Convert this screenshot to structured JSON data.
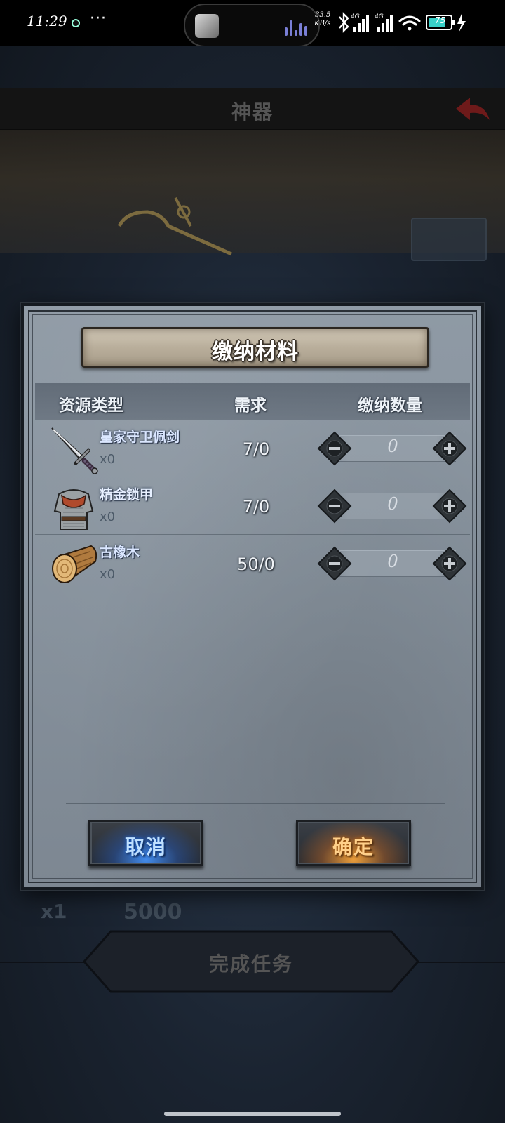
{
  "status_bar": {
    "time": "11:29",
    "more": "···",
    "net_speed_value": "33.5",
    "net_speed_unit": "KB/s",
    "battery": "75"
  },
  "background": {
    "title": "神器",
    "reward_qty": "x1",
    "reward_value": "5000",
    "complete_button": "完成任务"
  },
  "modal": {
    "title": "缴纳材料",
    "columns": {
      "type": "资源类型",
      "requirement": "需求",
      "quantity": "缴纳数量"
    },
    "rows": [
      {
        "name": "皇家守卫佩剑",
        "count": "x0",
        "requirement": "7/0",
        "quantity": "0",
        "icon": "sword-icon"
      },
      {
        "name": "精金锁甲",
        "count": "x0",
        "requirement": "7/0",
        "quantity": "0",
        "icon": "chainmail-armor-icon"
      },
      {
        "name": "古橡木",
        "count": "x0",
        "requirement": "50/0",
        "quantity": "0",
        "icon": "oak-log-icon"
      }
    ],
    "cancel_label": "取消",
    "confirm_label": "确定"
  },
  "colors": {
    "cancel_glow": "#3f8cff",
    "confirm_glow": "#ffaa3c",
    "panel": "#8a95a0"
  }
}
